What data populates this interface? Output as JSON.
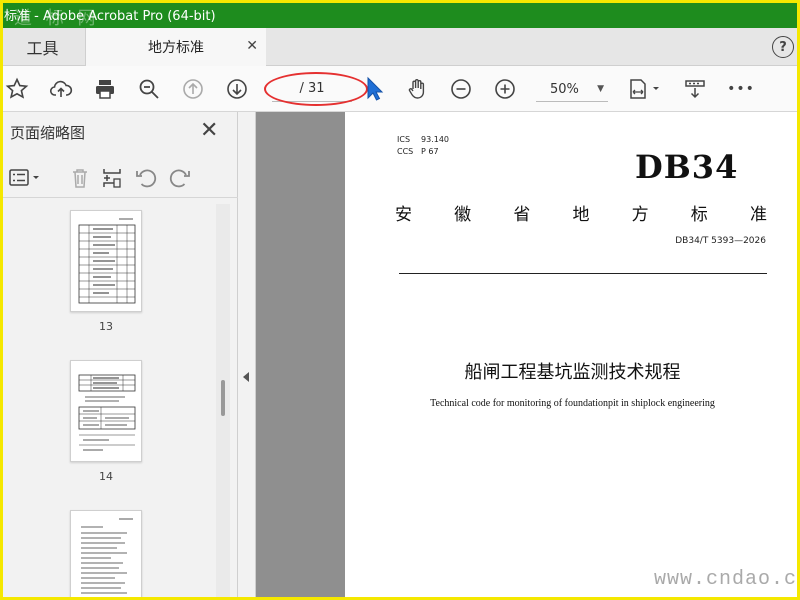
{
  "window": {
    "title": "标准 - Adobe Acrobat Pro (64-bit)",
    "title_watermark": "道 标 网"
  },
  "tabs": {
    "tools_label": "工具",
    "document_label": "地方标准",
    "close_glyph": "✕",
    "help_glyph": "?"
  },
  "toolbar": {
    "page_indicator": "/ 31",
    "zoom": "50%",
    "more_glyph": "•••"
  },
  "left_panel": {
    "title": "页面缩略图",
    "close_glyph": "✕",
    "thumbnails": [
      {
        "label": "13"
      },
      {
        "label": "14"
      },
      {
        "label": ""
      }
    ]
  },
  "document": {
    "ics_label": "ICS",
    "ics_value": "93.140",
    "ccs_label": "CCS",
    "ccs_value": "P 67",
    "db_code": "DB34",
    "standard_type_chars": [
      "安",
      "徽",
      "省",
      "地",
      "方",
      "标",
      "准"
    ],
    "standard_number": "DB34/T 5393—2026",
    "title_cn": "船闸工程基坑监测技术规程",
    "title_en": "Technical code for monitoring of foundationpit in shiplock engineering"
  },
  "watermark": "www.cndao.com",
  "colors": {
    "titlebar": "#1e8c1e",
    "frame": "#f5e800",
    "annotation": "#e53030",
    "cursor": "#1f6fd6"
  }
}
